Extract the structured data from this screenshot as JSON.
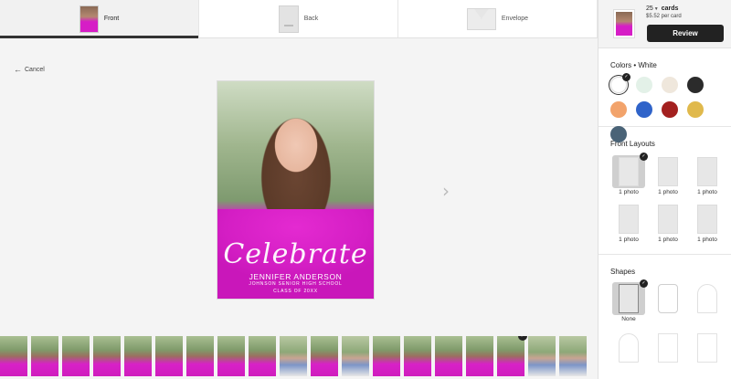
{
  "tabs": [
    {
      "label": "Front",
      "active": true
    },
    {
      "label": "Back",
      "active": false
    },
    {
      "label": "Envelope",
      "active": false
    }
  ],
  "cancel_label": "Cancel",
  "card": {
    "script": "Celebrate",
    "name": "JENNIFER ANDERSON",
    "school": "JOHNSON SENIOR HIGH SCHOOL",
    "class_of": "CLASS OF 20XX"
  },
  "summary": {
    "quantity": "25",
    "unit": "cards",
    "price": "$5.52 per card",
    "review_label": "Review"
  },
  "colors": {
    "title": "Colors • White",
    "swatches": [
      {
        "name": "white",
        "hex": "#ffffff",
        "selected": true
      },
      {
        "name": "mint",
        "hex": "#e3f1e8"
      },
      {
        "name": "cream",
        "hex": "#efe7dc"
      },
      {
        "name": "black",
        "hex": "#2b2b2b"
      },
      {
        "name": "orange",
        "hex": "#f2a36b"
      },
      {
        "name": "blue",
        "hex": "#2f63c9"
      },
      {
        "name": "red",
        "hex": "#a3201f"
      },
      {
        "name": "gold",
        "hex": "#e0b94c"
      },
      {
        "name": "slate",
        "hex": "#4a6377"
      }
    ]
  },
  "layouts": {
    "title": "Front Layouts",
    "items": [
      {
        "label": "1 photo",
        "selected": true
      },
      {
        "label": "1 photo"
      },
      {
        "label": "1 photo"
      },
      {
        "label": "1 photo"
      },
      {
        "label": "1 photo"
      },
      {
        "label": "1 photo"
      }
    ]
  },
  "shapes": {
    "title": "Shapes",
    "items": [
      {
        "label": "None",
        "selected": true
      },
      {
        "label": ""
      },
      {
        "label": ""
      },
      {
        "label": ""
      },
      {
        "label": ""
      },
      {
        "label": ""
      }
    ]
  },
  "strip_count": 19,
  "strip_selected_index": 16
}
